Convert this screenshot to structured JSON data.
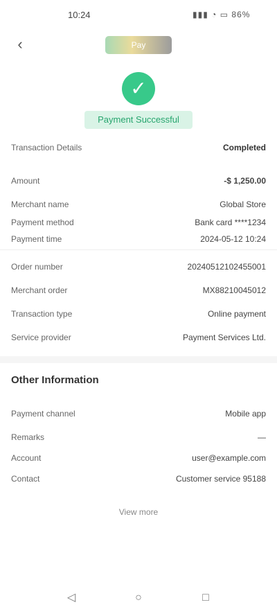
{
  "status": {
    "time": "10:24",
    "icons": "▮▮▮ ◔ ▭ 86%"
  },
  "header": {
    "back_icon": "chevron-left-icon",
    "logo_text": "Pay"
  },
  "success": {
    "icon": "check-icon",
    "text": "Payment Successful"
  },
  "summary": {
    "title_label": "Transaction Details",
    "title_value": "Completed",
    "amount_label": "Amount",
    "amount_value": "-$ 1,250.00",
    "rows": [
      {
        "label": "Merchant name",
        "value": "Global Store"
      },
      {
        "label": "Payment method",
        "value": "Bank card ****1234"
      },
      {
        "label": "Payment time",
        "value": "2024-05-12 10:24"
      }
    ]
  },
  "details": {
    "rows": [
      {
        "label": "Order number",
        "value": "20240512102455001"
      },
      {
        "label": "Merchant order",
        "value": "MX88210045012"
      },
      {
        "label": "Transaction type",
        "value": "Online payment"
      },
      {
        "label": "Service provider",
        "value": "Payment Services Ltd."
      }
    ]
  },
  "section2": {
    "title": "Other Information",
    "rows": [
      {
        "label": "Payment channel",
        "value": "Mobile app"
      },
      {
        "label": "Remarks",
        "value": "—"
      },
      {
        "label": "Account",
        "value": "user@example.com"
      },
      {
        "label": "Contact",
        "value": "Customer service 95188"
      }
    ]
  },
  "more_link": "View more",
  "navbar": {
    "items": [
      "back-nav-icon",
      "home-nav-icon",
      "recent-apps-icon"
    ]
  }
}
